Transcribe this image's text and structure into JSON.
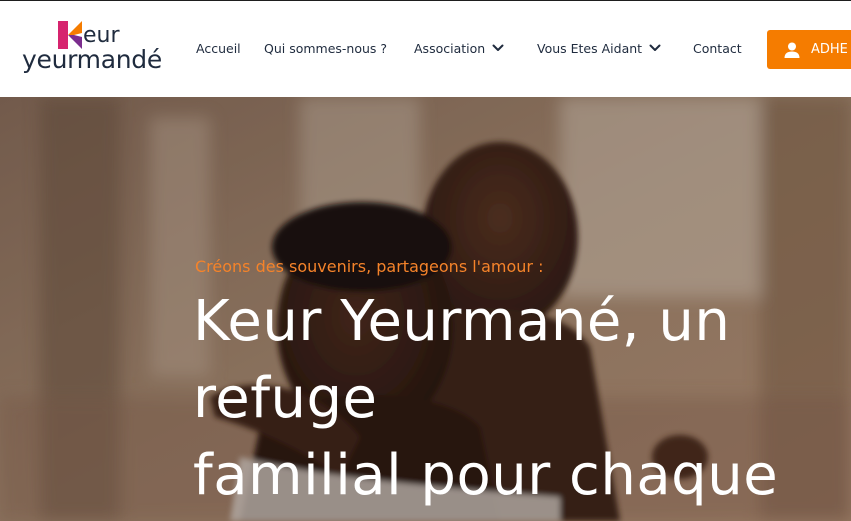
{
  "logo": {
    "line1": "eur",
    "line2": "yeurmandé",
    "colors": {
      "pink": "#d6246e",
      "orange": "#f57c00",
      "purple": "#7b2d8e",
      "text": "#1f2b3e"
    }
  },
  "nav": {
    "items": [
      {
        "label": "Accueil",
        "has_dropdown": false
      },
      {
        "label": "Qui sommes-nous ?",
        "has_dropdown": false
      },
      {
        "label": "Association",
        "has_dropdown": true
      },
      {
        "label": "Vous Etes Aidant",
        "has_dropdown": true
      },
      {
        "label": "Contact",
        "has_dropdown": false
      }
    ],
    "cta": {
      "label": "ADHE",
      "icon": "user-icon",
      "color": "#f57c00"
    }
  },
  "hero": {
    "eyebrow": "Créons des souvenirs, partageons l'amour :",
    "title_lines": [
      "Keur Yeurmané, un",
      "refuge",
      "familial pour chaque"
    ],
    "accent_color": "#f5832a"
  }
}
